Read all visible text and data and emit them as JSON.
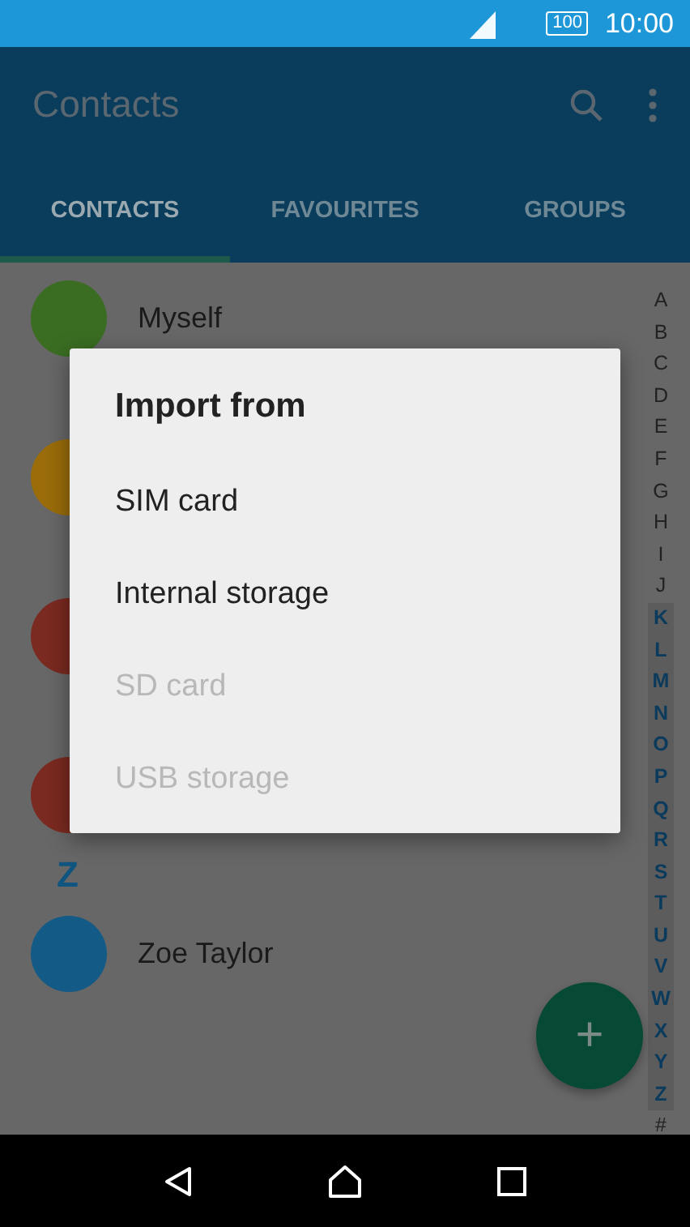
{
  "status_bar": {
    "battery": "100",
    "time": "10:00"
  },
  "app_bar": {
    "title": "Contacts"
  },
  "tabs": [
    {
      "label": "CONTACTS",
      "selected": true
    },
    {
      "label": "FAVOURITES",
      "selected": false
    },
    {
      "label": "GROUPS",
      "selected": false
    }
  ],
  "contacts": [
    {
      "kind": "contact",
      "name": "Myself",
      "color": "#3a6d22"
    },
    {
      "kind": "gap"
    },
    {
      "kind": "contact",
      "color": "#9a6c0a"
    },
    {
      "kind": "gap"
    },
    {
      "kind": "contact",
      "color": "#7a2a20"
    },
    {
      "kind": "gap"
    },
    {
      "kind": "contact",
      "color": "#7a2a20"
    },
    {
      "kind": "header",
      "letter": "Z"
    },
    {
      "kind": "contact",
      "name": "Zoe Taylor",
      "color": "#135a87"
    }
  ],
  "index": [
    {
      "letter": "A",
      "active": false
    },
    {
      "letter": "B",
      "active": false
    },
    {
      "letter": "C",
      "active": false
    },
    {
      "letter": "D",
      "active": false
    },
    {
      "letter": "E",
      "active": false
    },
    {
      "letter": "F",
      "active": false
    },
    {
      "letter": "G",
      "active": false
    },
    {
      "letter": "H",
      "active": false
    },
    {
      "letter": "I",
      "active": false
    },
    {
      "letter": "J",
      "active": false
    },
    {
      "letter": "K",
      "active": true
    },
    {
      "letter": "L",
      "active": true
    },
    {
      "letter": "M",
      "active": true
    },
    {
      "letter": "N",
      "active": true
    },
    {
      "letter": "O",
      "active": true
    },
    {
      "letter": "P",
      "active": true
    },
    {
      "letter": "Q",
      "active": true
    },
    {
      "letter": "R",
      "active": true
    },
    {
      "letter": "S",
      "active": true
    },
    {
      "letter": "T",
      "active": true
    },
    {
      "letter": "U",
      "active": true
    },
    {
      "letter": "V",
      "active": true
    },
    {
      "letter": "W",
      "active": true
    },
    {
      "letter": "X",
      "active": true
    },
    {
      "letter": "Y",
      "active": true
    },
    {
      "letter": "Z",
      "active": true
    },
    {
      "letter": "#",
      "active": false
    }
  ],
  "fab": {
    "label": "+"
  },
  "dialog": {
    "title": "Import from",
    "options": [
      {
        "label": "SIM card",
        "disabled": false
      },
      {
        "label": "Internal storage",
        "disabled": false
      },
      {
        "label": "SD card",
        "disabled": true
      },
      {
        "label": "USB storage",
        "disabled": true
      }
    ]
  }
}
